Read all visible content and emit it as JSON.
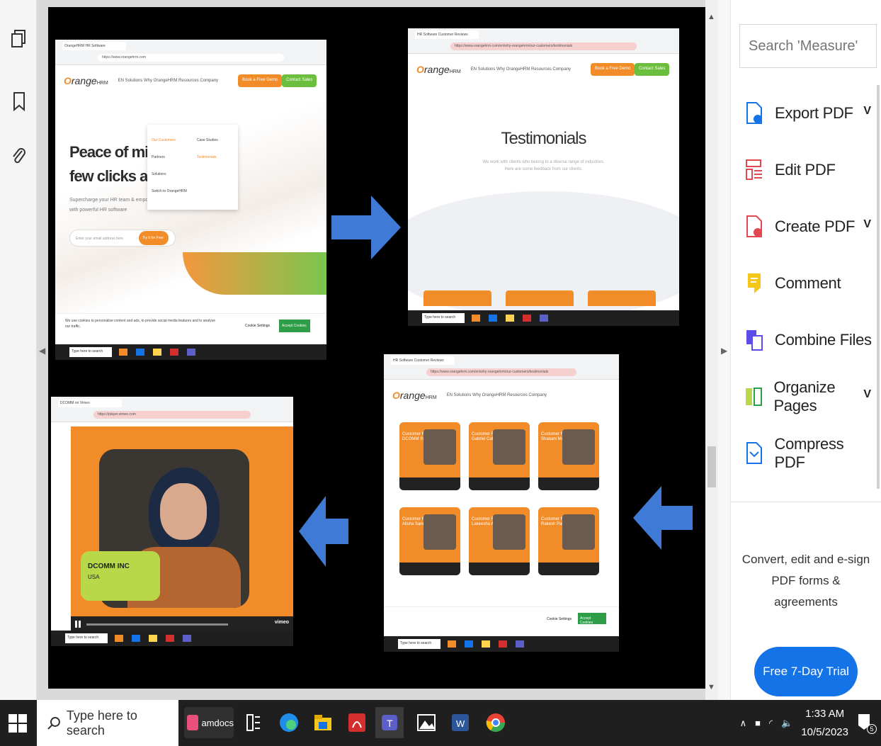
{
  "tools_pane": {
    "search_placeholder": "Search 'Measure'",
    "tools": [
      {
        "label": "Export PDF",
        "icon": "export-pdf-icon",
        "color": "#1473e6",
        "has_chevron": true
      },
      {
        "label": "Edit PDF",
        "icon": "edit-pdf-icon",
        "color": "#e34850",
        "has_chevron": false
      },
      {
        "label": "Create PDF",
        "icon": "create-pdf-icon",
        "color": "#e34850",
        "has_chevron": true
      },
      {
        "label": "Comment",
        "icon": "comment-icon",
        "color": "#f5c518",
        "has_chevron": false
      },
      {
        "label": "Combine Files",
        "icon": "combine-files-icon",
        "color": "#5c4de8",
        "has_chevron": false
      },
      {
        "label": "Organize Pages",
        "icon": "organize-pages-icon",
        "color": "#2d9d48",
        "has_chevron": true
      },
      {
        "label": "Compress PDF",
        "icon": "compress-pdf-icon",
        "color": "#1473e6",
        "has_chevron": false
      }
    ],
    "chevron": "V",
    "promo_text": "Convert, edit and e-sign PDF forms & agreements",
    "trial_button": "Free 7-Day Trial"
  },
  "document": {
    "shot1": {
      "tab": "OrangeHRM HR Software",
      "url": "https://www.orangehrm.com",
      "logo_prefix": "O",
      "logo_text": "range",
      "logo_suffix": "HRM",
      "nav": "EN   Solutions   Why OrangeHRM   Resources   Company",
      "book_demo": "Book a Free Demo",
      "contact_sales": "Contact Sales",
      "hero_line1": "Peace of mind is",
      "hero_line2": "few clicks away!",
      "hero_sub": "Supercharge your HR team & empower",
      "hero_sub2": "with powerful HR software",
      "email_placeholder": "Enter your email address here",
      "try_free": "Try it for Free",
      "menu": [
        "Our Customers",
        "Partners",
        "Solutions",
        "Switch to OrangeHRM"
      ],
      "menu_right": [
        "Case Studies",
        "Testimonials"
      ],
      "cookie_text": "We use cookies to personalise content and ads, to provide social media features and to analyse our traffic.",
      "cookie_settings": "Cookie Settings",
      "accept_cookies": "Accept Cookies"
    },
    "shot2": {
      "tab": "HR Software Customer Reviews",
      "url": "https://www.orangehrm.com/en/why-orangehrm/our-customers/testimonials",
      "title": "Testimonials",
      "sub1": "We work with clients who belong to a diverse range of industries.",
      "sub2": "Here are some feedback from our clients."
    },
    "shot3": {
      "tab": "HR Software Customer Reviews",
      "cards": [
        {
          "heading": "Customer Reviews",
          "company": "DCOMM INC"
        },
        {
          "heading": "Customer Reviews",
          "company": "Gabriel Caffarelo"
        },
        {
          "heading": "Customer Reviews",
          "company": "Shabani Mchabi"
        },
        {
          "heading": "Customer Reviews",
          "company": "Alisha Sandy"
        },
        {
          "heading": "Customer Reviews",
          "company": "Lakeesha Arbeiter"
        },
        {
          "heading": "Customer Reviews",
          "company": "Rakesh Patnik"
        }
      ],
      "cookie_settings": "Cookie Settings",
      "accept_cookies": "Accept Cookies"
    },
    "shot4": {
      "tab": "DCOMM on Vimeo",
      "url": "https://player.vimeo.com",
      "company": "DCOMM INC",
      "country": "USA",
      "vimeo": "vimeo"
    },
    "mini_search": "Type here to search"
  },
  "taskbar": {
    "search_placeholder": "Type here to search",
    "amdocs_label": "amdocs",
    "time": "1:33 AM",
    "date": "10/5/2023",
    "notification_count": "5"
  },
  "colors": {
    "accent": "#1473e6",
    "orange": "#f28c28",
    "green": "#6cbf3c",
    "arrow": "#3f7bd6"
  }
}
